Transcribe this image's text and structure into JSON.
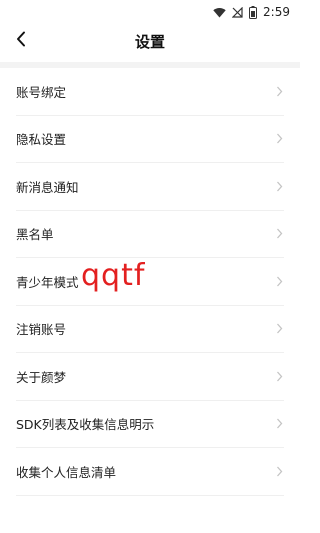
{
  "status_bar": {
    "time": "2:59",
    "icons": [
      "wifi-icon",
      "no-signal-icon",
      "battery-icon"
    ]
  },
  "nav": {
    "back_icon": "chevron-left-icon",
    "title": "设置"
  },
  "settings": [
    {
      "label": "账号绑定"
    },
    {
      "label": "隐私设置"
    },
    {
      "label": "新消息通知"
    },
    {
      "label": "黑名单"
    },
    {
      "label": "青少年模式"
    },
    {
      "label": "注销账号"
    },
    {
      "label": "关于颜梦"
    },
    {
      "label": "SDK列表及收集信息明示"
    },
    {
      "label": "收集个人信息清单"
    }
  ],
  "watermark": "qqtf",
  "colors": {
    "watermark": "#e32020",
    "band": "#f3f3f3",
    "chevron": "#c4c4c4"
  }
}
